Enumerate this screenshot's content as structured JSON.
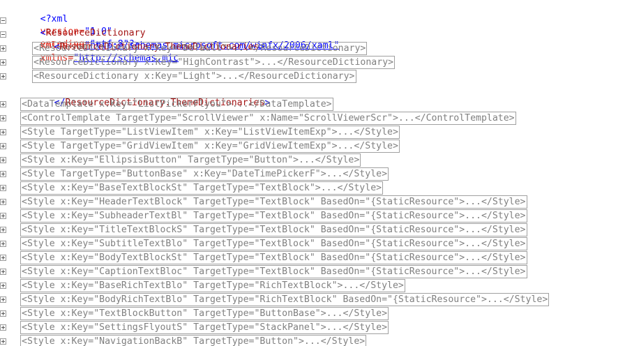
{
  "xml_decl": {
    "open": "<?xml",
    "version_attr": "version=",
    "version_val": "\"1.0\"",
    "encoding_attr": "encoding=",
    "encoding_val": "\"utf-8\"",
    "close": "?>"
  },
  "root": {
    "open_bracket": "<",
    "tag": "ResourceDictionary",
    "xmlns_x_attr": "xmlns:x=",
    "xmlns_x_val": "\"http://schemas.microsoft.com/winfx/2006/xaml\"",
    "xmlns_attr": "xmlns=",
    "xmlns_val": "\"http://schemas.mic"
  },
  "theme_open": {
    "lt": "<",
    "tag": "ResourceDictionary.ThemeDictionaries",
    "gt": ">"
  },
  "theme_close": {
    "lt": "</",
    "tag": "ResourceDictionary.ThemeDictionaries",
    "gt": ">"
  },
  "theme_items": [
    "<ResourceDictionary x:Key=\"Default\">...</ResourceDictionary>",
    "<ResourceDictionary x:Key=\"HighContrast\">...</ResourceDictionary>",
    "<ResourceDictionary x:Key=\"Light\">...</ResourceDictionary>"
  ],
  "collapsed_items": [
    "<DataTemplate x:Key=\"ListPickerFlyou\">...</DataTemplate>",
    "<ControlTemplate TargetType=\"ScrollViewer\" x:Name=\"ScrollViewerScr\">...</ControlTemplate>",
    "<Style TargetType=\"ListViewItem\" x:Key=\"ListViewItemExp\">...</Style>",
    "<Style TargetType=\"GridViewItem\" x:Key=\"GridViewItemExp\">...</Style>",
    "<Style x:Key=\"EllipsisButton\" TargetType=\"Button\">...</Style>",
    "<Style TargetType=\"ButtonBase\" x:Key=\"DateTimePickerF\">...</Style>",
    "<Style x:Key=\"BaseTextBlockSt\" TargetType=\"TextBlock\">...</Style>",
    "<Style x:Key=\"HeaderTextBlock\" TargetType=\"TextBlock\" BasedOn=\"{StaticResource\">...</Style>",
    "<Style x:Key=\"SubheaderTextBl\" TargetType=\"TextBlock\" BasedOn=\"{StaticResource\">...</Style>",
    "<Style x:Key=\"TitleTextBlockS\" TargetType=\"TextBlock\" BasedOn=\"{StaticResource\">...</Style>",
    "<Style x:Key=\"SubtitleTextBlo\" TargetType=\"TextBlock\" BasedOn=\"{StaticResource\">...</Style>",
    "<Style x:Key=\"BodyTextBlockSt\" TargetType=\"TextBlock\" BasedOn=\"{StaticResource\">...</Style>",
    "<Style x:Key=\"CaptionTextBloc\" TargetType=\"TextBlock\" BasedOn=\"{StaticResource\">...</Style>",
    "<Style x:Key=\"BaseRichTextBlo\" TargetType=\"RichTextBlock\">...</Style>",
    "<Style x:Key=\"BodyRichTextBlo\" TargetType=\"RichTextBlock\" BasedOn=\"{StaticResource\">...</Style>",
    "<Style x:Key=\"TextBlockButton\" TargetType=\"ButtonBase\">...</Style>",
    "<Style x:Key=\"SettingsFlyoutS\" TargetType=\"StackPanel\">...</Style>",
    "<Style x:Key=\"NavigationBackB\" TargetType=\"Button\">...</Style>"
  ],
  "colors": {
    "tag": "#a31515",
    "attribute": "#e0281a",
    "value": "#0000ff",
    "collapsed_text": "#808080"
  }
}
